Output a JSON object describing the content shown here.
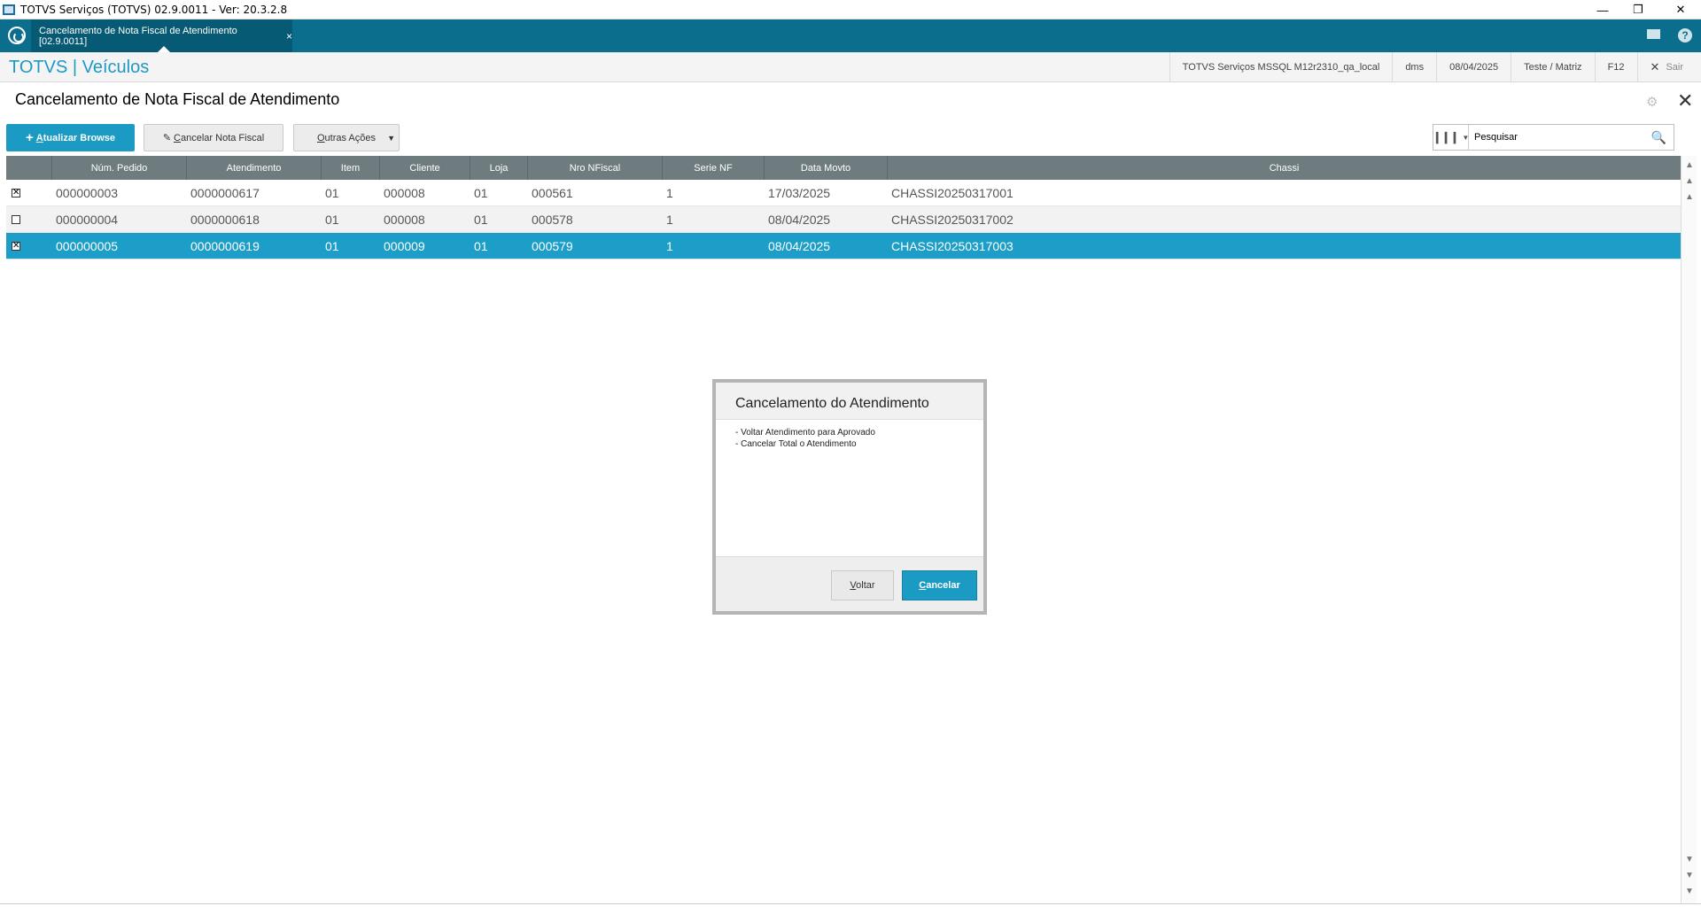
{
  "window": {
    "title": "TOTVS Serviços (TOTVS) 02.9.0011 - Ver: 20.3.2.8"
  },
  "tab": {
    "label": "Cancelamento de Nota Fiscal de Atendimento [02.9.0011]",
    "close": "×"
  },
  "brand": "TOTVS | Veículos",
  "infobar": {
    "environment": "TOTVS Serviços MSSQL M12r2310_qa_local",
    "user": "dms",
    "date": "08/04/2025",
    "branch": "Teste / Matriz",
    "shortcut": "F12",
    "exit_label": "Sair"
  },
  "page": {
    "title": "Cancelamento de Nota Fiscal de Atendimento"
  },
  "toolbar": {
    "refresh_label": "Atualizar Browse",
    "cancel_nf_label": "Cancelar Nota Fiscal",
    "other_actions_label": "Outras Ações"
  },
  "search": {
    "value": "Pesquisar"
  },
  "grid": {
    "columns": [
      "Núm. Pedido",
      "Atendimento",
      "Item",
      "Cliente",
      "Loja",
      "Nro NFiscal",
      "Serie NF",
      "Data Movto",
      "Chassi"
    ],
    "rows": [
      {
        "checked": true,
        "cells": [
          "000000003",
          "0000000617",
          "01",
          "000008",
          "01",
          "000561",
          "1",
          "17/03/2025",
          "CHASSI20250317001"
        ]
      },
      {
        "checked": false,
        "cells": [
          "000000004",
          "0000000618",
          "01",
          "000008",
          "01",
          "000578",
          "1",
          "08/04/2025",
          "CHASSI20250317002"
        ]
      },
      {
        "checked": true,
        "cells": [
          "000000005",
          "0000000619",
          "01",
          "000009",
          "01",
          "000579",
          "1",
          "08/04/2025",
          "CHASSI20250317003"
        ]
      }
    ],
    "selected_row": 2
  },
  "dialog": {
    "title": "Cancelamento do Atendimento",
    "lines": [
      "- Voltar Atendimento para Aprovado",
      "- Cancelar Total o Atendimento"
    ],
    "back_label": "Voltar",
    "cancel_label": "Cancelar"
  },
  "colors": {
    "accent": "#1b9bc4",
    "header": "#0b6e8c",
    "grid_header": "#6e7c80",
    "selected_row": "#1c9ec8"
  },
  "icons": {
    "app": "app-window-icon",
    "logo": "totvs-logo-icon",
    "mail": "mail-icon",
    "help": "help-icon",
    "gear": "gear-icon",
    "close": "close-icon",
    "search": "search-icon",
    "columns": "columns-icon"
  }
}
